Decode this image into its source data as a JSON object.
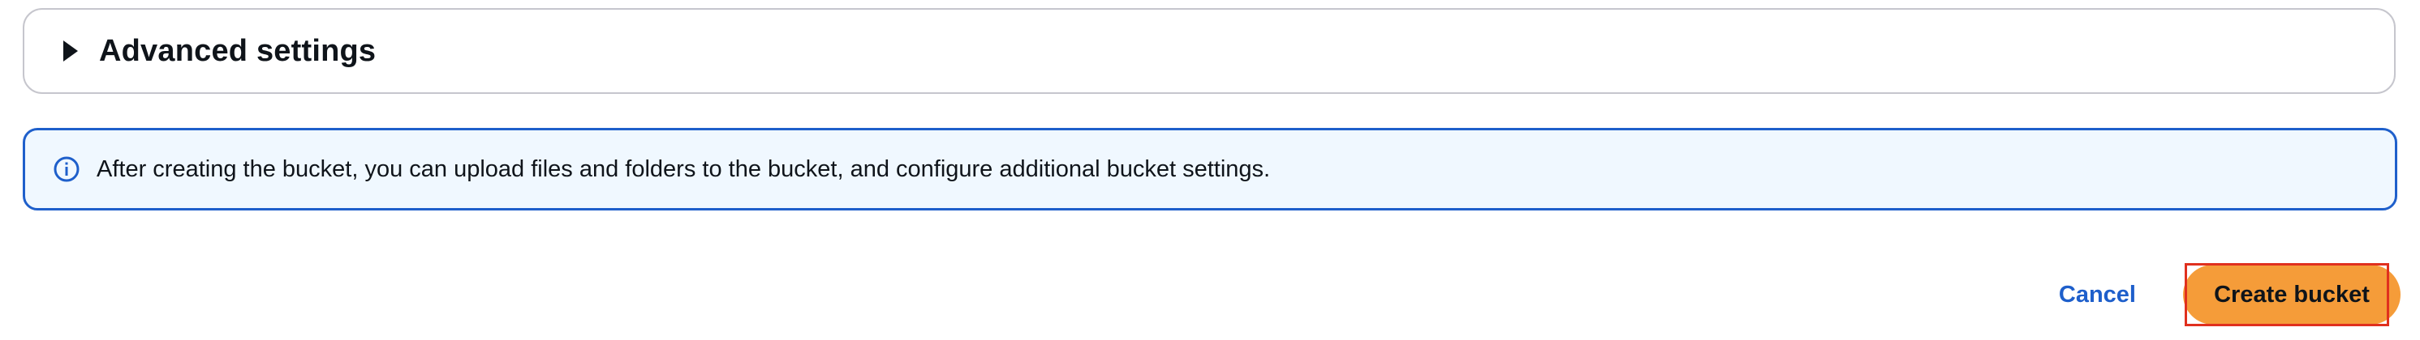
{
  "advanced_settings": {
    "title": "Advanced settings",
    "expanded": false,
    "icon": "caret-right-icon"
  },
  "info_alert": {
    "icon": "info-icon",
    "message": "After creating the bucket, you can upload files and folders to the bucket, and configure additional bucket settings."
  },
  "actions": {
    "cancel_label": "Cancel",
    "create_label": "Create bucket",
    "create_highlighted": true
  },
  "colors": {
    "primary_button": "#f59c39",
    "link": "#1e5fcb",
    "alert_border": "#1e5fcb",
    "alert_background": "#f0f8ff",
    "highlight": "#e0301e"
  }
}
